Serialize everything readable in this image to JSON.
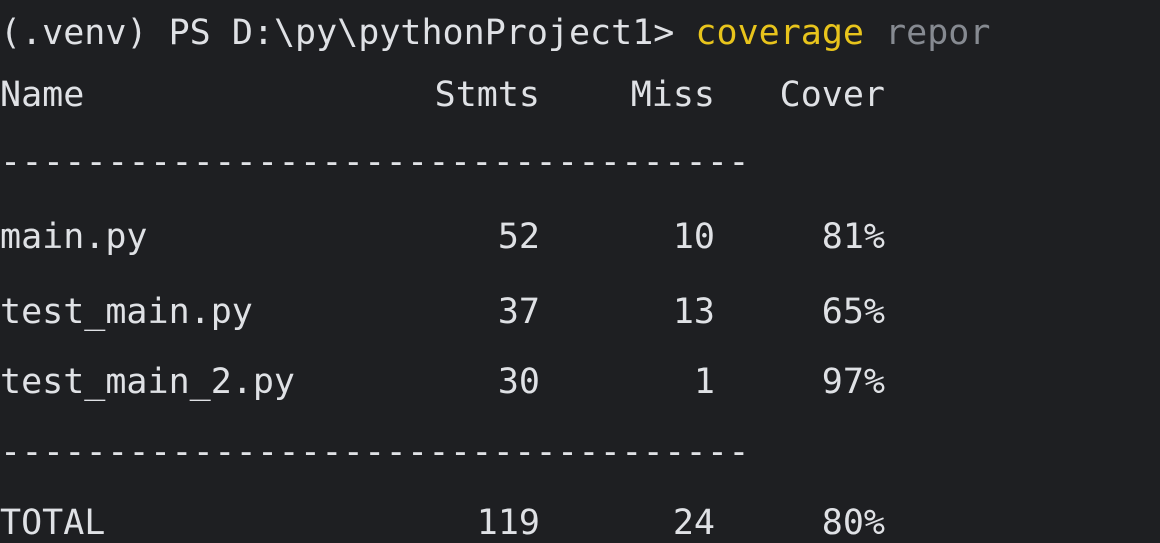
{
  "prompt": {
    "env": "(.venv)",
    "shell": "PS",
    "path": "D:\\py\\pythonProject1>",
    "command": "coverage",
    "argument": "repor"
  },
  "table": {
    "headers": [
      "Name",
      "Stmts",
      "Miss",
      "Cover"
    ],
    "separator": "-----------------------------------",
    "rows": [
      {
        "name": "main.py",
        "stmts": "52",
        "miss": "10",
        "cover": "81%"
      },
      {
        "name": "test_main.py",
        "stmts": "37",
        "miss": "13",
        "cover": "65%"
      },
      {
        "name": "test_main_2.py",
        "stmts": "30",
        "miss": "1",
        "cover": "97%"
      }
    ],
    "total": {
      "name": "TOTAL",
      "stmts": "119",
      "miss": "24",
      "cover": "80%"
    }
  },
  "colors": {
    "background": "#1e1f22",
    "text": "#dfe1e5",
    "command": "#e8c41c",
    "argument": "#868a91"
  }
}
